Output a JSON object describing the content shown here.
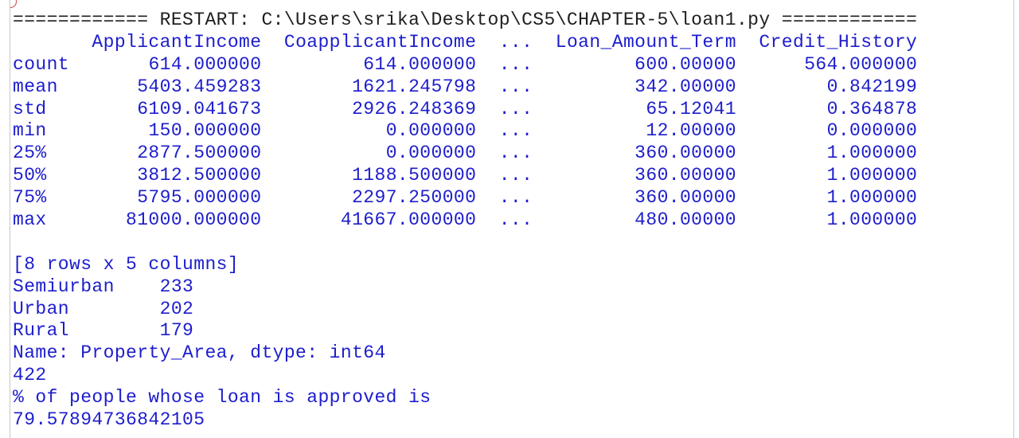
{
  "restart_line": "============ RESTART: C:\\Users\\srika\\Desktop\\CS5\\CHAPTER-5\\loan1.py ============",
  "table": {
    "columns": [
      "ApplicantIncome",
      "CoapplicantIncome",
      "...",
      "Loan_Amount_Term",
      "Credit_History"
    ],
    "rows": [
      {
        "label": "count",
        "values": [
          "614.000000",
          "614.000000",
          "...",
          "600.00000",
          "564.000000"
        ]
      },
      {
        "label": "mean",
        "values": [
          "5403.459283",
          "1621.245798",
          "...",
          "342.00000",
          "0.842199"
        ]
      },
      {
        "label": "std",
        "values": [
          "6109.041673",
          "2926.248369",
          "...",
          "65.12041",
          "0.364878"
        ]
      },
      {
        "label": "min",
        "values": [
          "150.000000",
          "0.000000",
          "...",
          "12.00000",
          "0.000000"
        ]
      },
      {
        "label": "25%",
        "values": [
          "2877.500000",
          "0.000000",
          "...",
          "360.00000",
          "1.000000"
        ]
      },
      {
        "label": "50%",
        "values": [
          "3812.500000",
          "1188.500000",
          "...",
          "360.00000",
          "1.000000"
        ]
      },
      {
        "label": "75%",
        "values": [
          "5795.000000",
          "2297.250000",
          "...",
          "360.00000",
          "1.000000"
        ]
      },
      {
        "label": "max",
        "values": [
          "81000.000000",
          "41667.000000",
          "...",
          "480.00000",
          "1.000000"
        ]
      }
    ]
  },
  "shape_line": "[8 rows x 5 columns]",
  "value_counts": [
    {
      "label": "Semiurban",
      "count": "233"
    },
    {
      "label": "Urban",
      "count": "202"
    },
    {
      "label": "Rural",
      "count": "179"
    }
  ],
  "series_info": "Name: Property_Area, dtype: int64",
  "approved_count": "422",
  "approved_text": "% of people whose loan is approved is",
  "approved_percent": "79.57894736842105",
  "colors": {
    "stdout": "#1d1dcd",
    "restart": "#1e1e1e",
    "background": "#ffffff"
  }
}
